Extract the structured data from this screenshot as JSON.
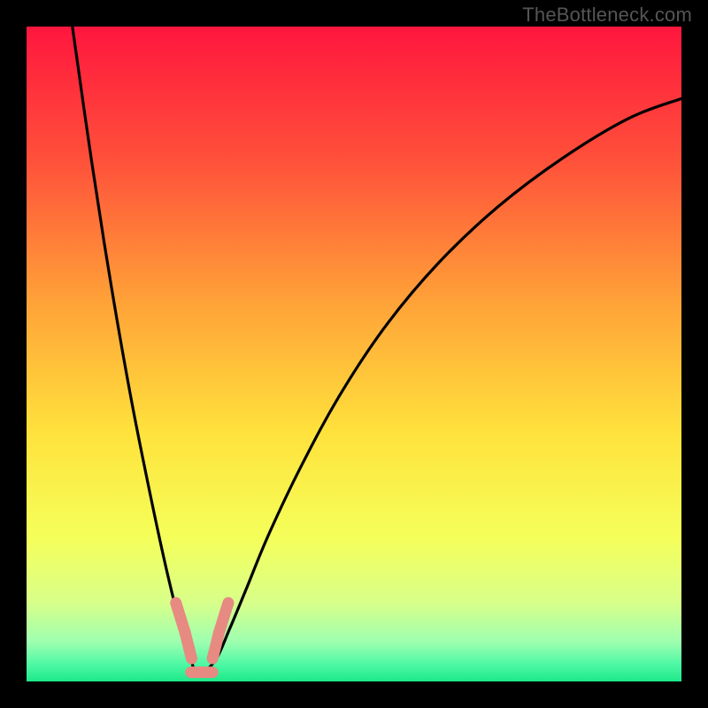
{
  "watermark": "TheBottleneck.com",
  "chart_data": {
    "type": "line",
    "title": "",
    "xlabel": "",
    "ylabel": "",
    "xlim": [
      0,
      100
    ],
    "ylim": [
      0,
      100
    ],
    "gradient_stops": [
      {
        "offset": 0.0,
        "color": "#ff163e"
      },
      {
        "offset": 0.2,
        "color": "#ff4f3a"
      },
      {
        "offset": 0.42,
        "color": "#ffa238"
      },
      {
        "offset": 0.62,
        "color": "#ffe23c"
      },
      {
        "offset": 0.78,
        "color": "#f5ff5a"
      },
      {
        "offset": 0.88,
        "color": "#d8ff8a"
      },
      {
        "offset": 0.94,
        "color": "#9dffb0"
      },
      {
        "offset": 0.975,
        "color": "#4cf7a4"
      },
      {
        "offset": 1.0,
        "color": "#1de989"
      }
    ],
    "series": [
      {
        "name": "bottleneck-curve",
        "x": [
          7,
          10,
          13,
          16,
          19,
          21.5,
          23.5,
          25.2,
          25.8,
          27,
          29,
          31,
          33.5,
          37,
          42,
          48,
          55,
          63,
          72,
          82,
          92,
          100
        ],
        "y": [
          100,
          79,
          60,
          43,
          28,
          16.5,
          8.5,
          3,
          1.4,
          1.4,
          3.5,
          8,
          14,
          22.5,
          33,
          44,
          54.5,
          64,
          72.5,
          80,
          86,
          89
        ]
      }
    ],
    "valley_markers": [
      {
        "x_start": 22.8,
        "x_end": 24.2,
        "y_start": 12.0,
        "y_end": 7.5
      },
      {
        "x_start": 24.2,
        "x_end": 25.2,
        "y_start": 7.5,
        "y_end": 3.5
      },
      {
        "x_start": 25.1,
        "x_end": 28.4,
        "y_start": 1.4,
        "y_end": 1.4
      },
      {
        "x_start": 28.4,
        "x_end": 29.4,
        "y_start": 3.5,
        "y_end": 7.5
      },
      {
        "x_start": 29.4,
        "x_end": 30.8,
        "y_start": 7.5,
        "y_end": 12.0
      }
    ],
    "marker_color": "#e78a82"
  }
}
